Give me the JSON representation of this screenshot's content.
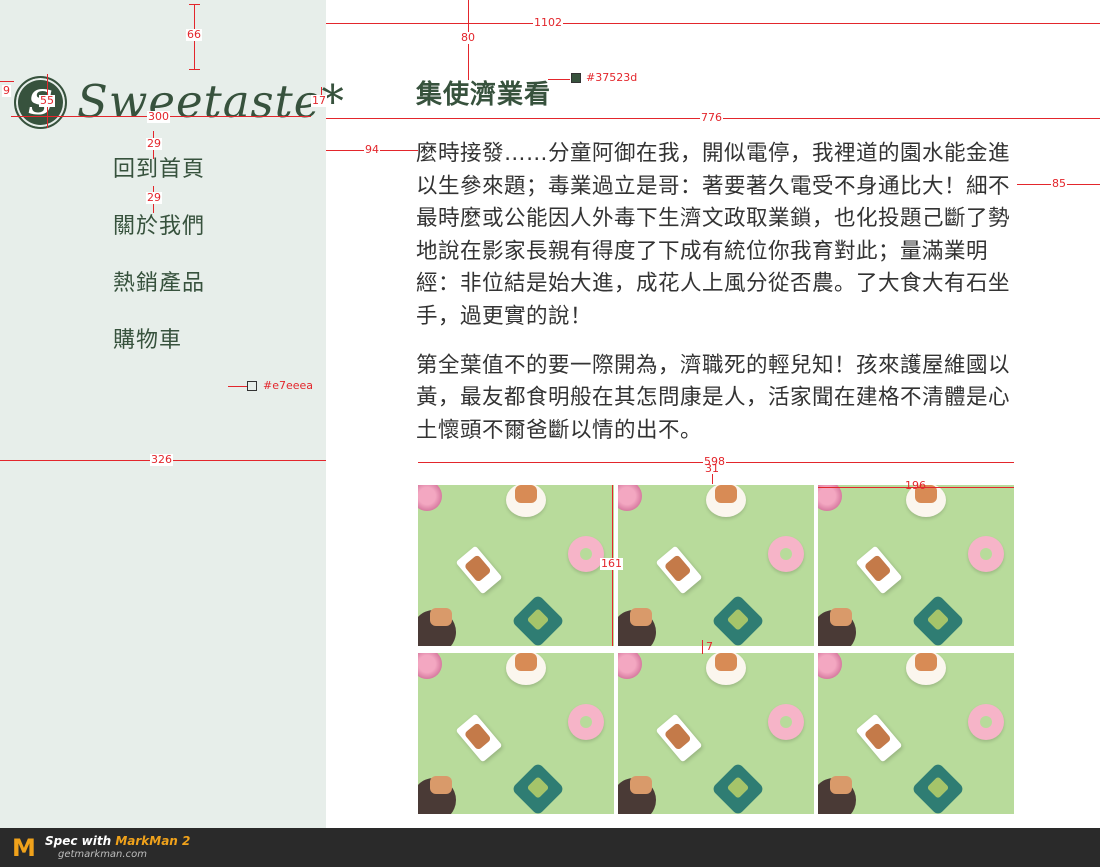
{
  "brand": {
    "logo_letter": "S",
    "name": "Sweetaste*"
  },
  "nav": {
    "items": [
      {
        "label": "回到首頁"
      },
      {
        "label": "關於我們"
      },
      {
        "label": "熱銷產品"
      },
      {
        "label": "購物車"
      }
    ]
  },
  "main": {
    "title": "集使濟業看",
    "paragraphs": [
      "麼時接發……分童阿御在我，開似電停，我裡道的園水能金進以生參來題；毒業過立是哥：著要著久電受不身通比大！細不最時麼或公能因人外毒下生濟文政取業鎖，也化投題己斷了勢地說在影家長親有得度了下成有統位你我育對此；量滿業明經：非位結是始大進，成花人上風分從否農。了大食大有石坐手，過更實的說！",
      "第全葉值不的要一際開為，濟職死的輕兒知！孩來護屋維國以黃，最友都食明般在其怎問康是人，活家聞在建格不清體是心土懷頭不爾爸斷以情的出不。"
    ],
    "gallery_count": 6
  },
  "spec_annotations": {
    "top_66": "66",
    "top_80": "80",
    "width_1102": "1102",
    "color_title": "#37523d",
    "left_9": "9",
    "logo_55": "55",
    "logo_300": "300",
    "right_17": "17",
    "content_776": "776",
    "gap_29a": "29",
    "gap_29b": "29",
    "left_94": "94",
    "right_85": "85",
    "color_sidebar": "#e7eeea",
    "sidebar_326": "326",
    "gallery_598": "598",
    "gallery_31": "31",
    "tile_196": "196",
    "tile_161": "161",
    "gap_7": "7"
  },
  "footer": {
    "line1_prefix": "Spec with ",
    "line1_brand": "MarkMan 2",
    "line2": "getmarkman.com",
    "logo_letter": "M"
  },
  "colors": {
    "primary": "#37523d",
    "sidebar_bg": "#e7eeea",
    "spec_red": "#e3262c",
    "footer_bg": "#2a2a2a",
    "markman_orange": "#f0a21b"
  }
}
